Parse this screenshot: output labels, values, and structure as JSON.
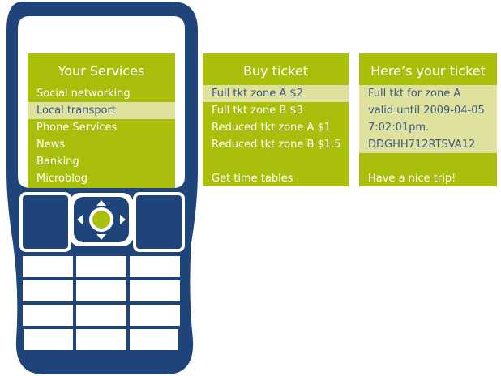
{
  "colors": {
    "phone_body": "#1f447a",
    "screen_bg": "#a9bf0c",
    "highlight_row": "#dfe19e",
    "dpad_center": "#a9bf0c"
  },
  "phone_screen": {
    "title": "Your Services",
    "items": [
      "Social networking",
      "Local transport",
      "Phone Services",
      "News",
      "Banking",
      "Microblog"
    ],
    "selected_index": 1
  },
  "buy_screen": {
    "title": "Buy ticket",
    "items": [
      "Full tkt zone A $2",
      "Full tkt zone B $3",
      "Reduced tkt zone A $1",
      "Reduced tkt zone B $1.5"
    ],
    "selected_index": 0,
    "footer": "Get time tables"
  },
  "ticket_screen": {
    "title": "Here’s your ticket",
    "lines": [
      "Full tkt for zone A",
      "valid until 2009-04-05",
      "7:02:01pm.",
      "DDGHH712RTSVA12"
    ],
    "footer": "Have a nice trip!"
  },
  "icons": {
    "dpad_up": "triangle-up",
    "dpad_down": "triangle-down",
    "dpad_left": "triangle-left",
    "dpad_right": "triangle-right",
    "dpad_center": "circle"
  }
}
